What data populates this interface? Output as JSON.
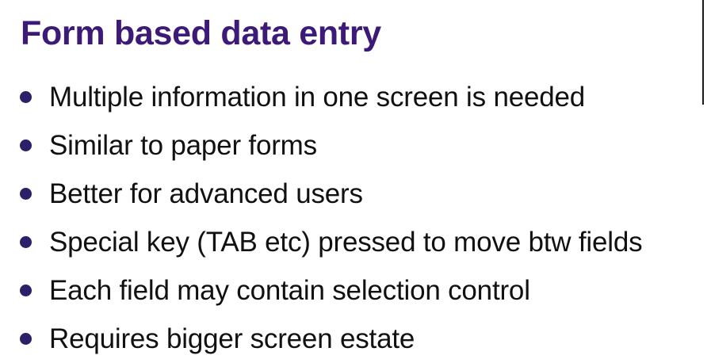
{
  "slide": {
    "title": "Form based data entry",
    "title_color": "#3d1a78",
    "bullet_color": "#2e1f6b",
    "bullets": [
      "Multiple information in one screen is needed",
      "Similar to paper forms",
      "Better for advanced users",
      "Special key (TAB etc) pressed to move btw fields",
      "Each field may contain selection control",
      "Requires bigger screen estate"
    ]
  }
}
